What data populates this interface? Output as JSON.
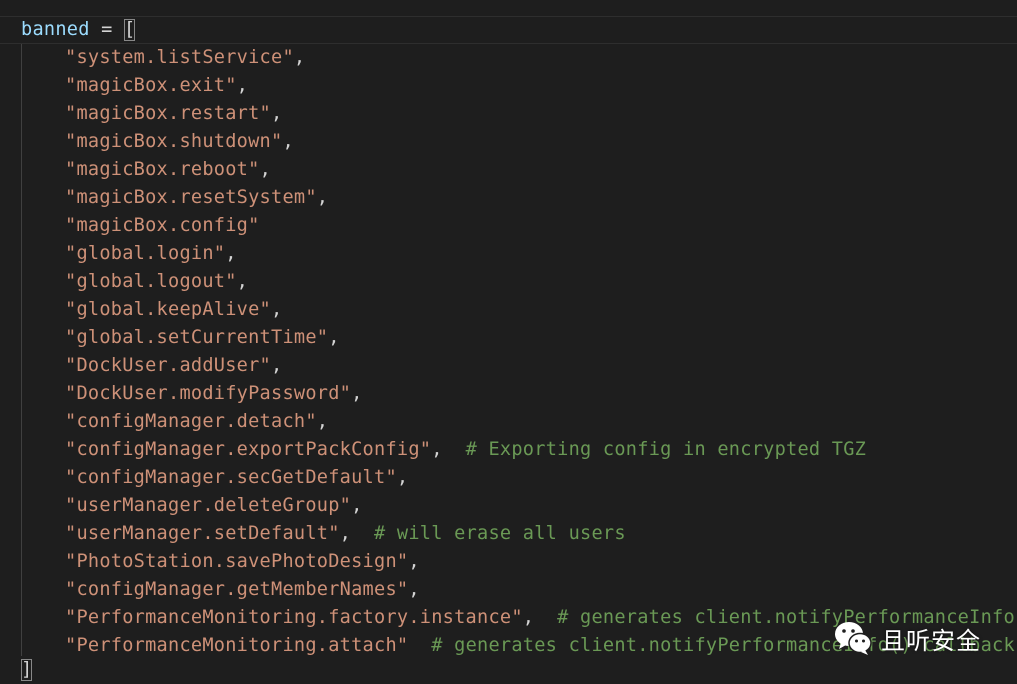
{
  "code": {
    "var_name": "banned",
    "assign_op": " = ",
    "open_bracket": "[",
    "close_bracket": "]",
    "lines": [
      {
        "str": "\"system.listService\"",
        "tail": ",",
        "comment": ""
      },
      {
        "str": "\"magicBox.exit\"",
        "tail": ",",
        "comment": ""
      },
      {
        "str": "\"magicBox.restart\"",
        "tail": ",",
        "comment": ""
      },
      {
        "str": "\"magicBox.shutdown\"",
        "tail": ",",
        "comment": ""
      },
      {
        "str": "\"magicBox.reboot\"",
        "tail": ",",
        "comment": ""
      },
      {
        "str": "\"magicBox.resetSystem\"",
        "tail": ",",
        "comment": ""
      },
      {
        "str": "\"magicBox.config\"",
        "tail": "",
        "comment": ""
      },
      {
        "str": "\"global.login\"",
        "tail": ",",
        "comment": ""
      },
      {
        "str": "\"global.logout\"",
        "tail": ",",
        "comment": ""
      },
      {
        "str": "\"global.keepAlive\"",
        "tail": ",",
        "comment": ""
      },
      {
        "str": "\"global.setCurrentTime\"",
        "tail": ",",
        "comment": ""
      },
      {
        "str": "\"DockUser.addUser\"",
        "tail": ",",
        "comment": ""
      },
      {
        "str": "\"DockUser.modifyPassword\"",
        "tail": ",",
        "comment": ""
      },
      {
        "str": "\"configManager.detach\"",
        "tail": ",",
        "comment": ""
      },
      {
        "str": "\"configManager.exportPackConfig\"",
        "tail": ",  ",
        "comment": "# Exporting config in encrypted TGZ"
      },
      {
        "str": "\"configManager.secGetDefault\"",
        "tail": ",",
        "comment": ""
      },
      {
        "str": "\"userManager.deleteGroup\"",
        "tail": ",",
        "comment": ""
      },
      {
        "str": "\"userManager.setDefault\"",
        "tail": ",  ",
        "comment": "# will erase all users"
      },
      {
        "str": "\"PhotoStation.savePhotoDesign\"",
        "tail": ",",
        "comment": ""
      },
      {
        "str": "\"configManager.getMemberNames\"",
        "tail": ",",
        "comment": ""
      },
      {
        "str": "\"PerformanceMonitoring.factory.instance\"",
        "tail": ",  ",
        "comment": "# generates client.notifyPerformanceInfo()"
      },
      {
        "str": "\"PerformanceMonitoring.attach\"",
        "tail": "  ",
        "comment": "# generates client.notifyPerformanceInfo() callback"
      }
    ]
  },
  "watermark": {
    "icon": "wechat-icon",
    "text": "且听安全"
  },
  "colors": {
    "background": "#1e1e1e",
    "variable": "#9cdcfe",
    "string": "#ce9178",
    "comment": "#6a9955",
    "punctuation": "#d4d4d4"
  }
}
